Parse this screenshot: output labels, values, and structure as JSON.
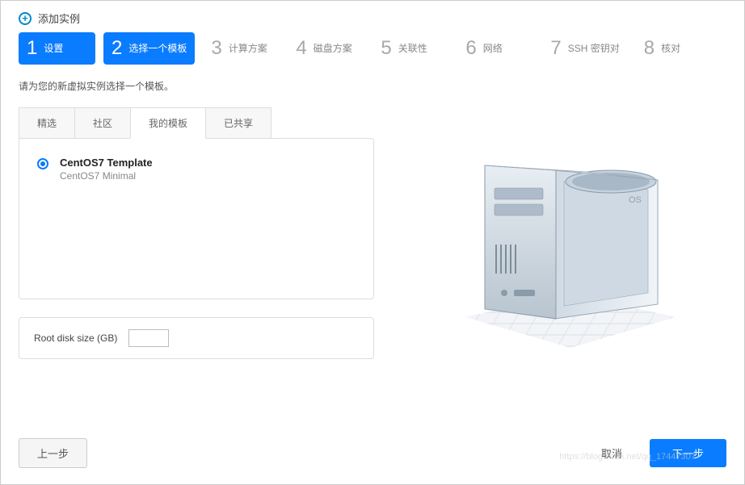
{
  "header": {
    "title": "添加实例"
  },
  "steps": [
    {
      "num": "1",
      "label": "设置",
      "active": true
    },
    {
      "num": "2",
      "label": "选择一个模板",
      "active": true
    },
    {
      "num": "3",
      "label": "计算方案",
      "active": false
    },
    {
      "num": "4",
      "label": "磁盘方案",
      "active": false
    },
    {
      "num": "5",
      "label": "关联性",
      "active": false
    },
    {
      "num": "6",
      "label": "网络",
      "active": false
    },
    {
      "num": "7",
      "label": "SSH 密钥对",
      "active": false
    },
    {
      "num": "8",
      "label": "核对",
      "active": false
    }
  ],
  "instruction": "请为您的新虚拟实例选择一个模板。",
  "tabs": [
    {
      "label": "精选",
      "active": false
    },
    {
      "label": "社区",
      "active": false
    },
    {
      "label": "我的模板",
      "active": true
    },
    {
      "label": "已共享",
      "active": false
    }
  ],
  "templates": [
    {
      "name": "CentOS7 Template",
      "desc": "CentOS7 Minimal",
      "selected": true
    }
  ],
  "disk": {
    "label": "Root disk size (GB)",
    "value": ""
  },
  "illustration": {
    "os_label": "OS"
  },
  "footer": {
    "prev": "上一步",
    "cancel": "取消",
    "next": "下一步"
  },
  "watermark": "https://blog.csdn.net/qq_17447307"
}
